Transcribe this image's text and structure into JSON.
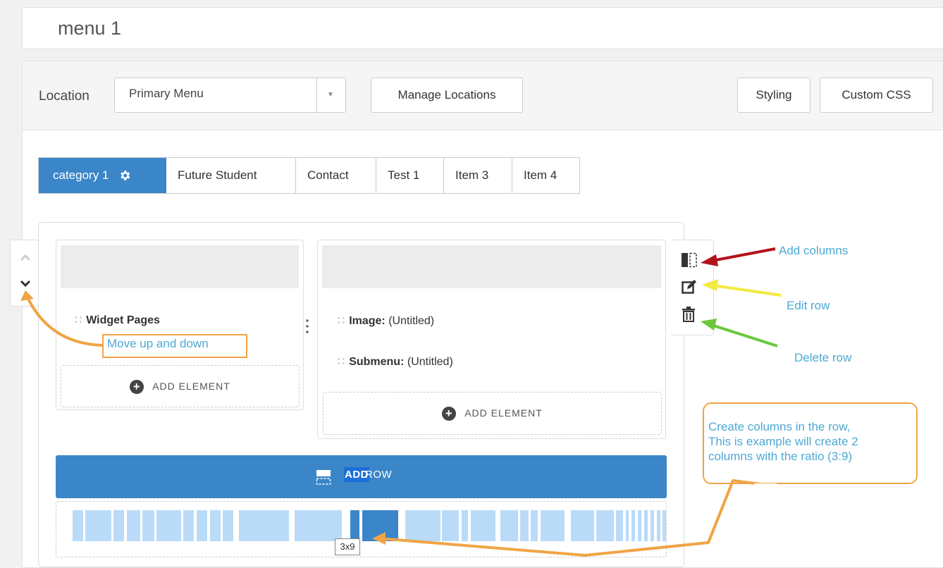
{
  "menu": {
    "name": "menu 1"
  },
  "location_bar": {
    "label": "Location",
    "select_value": "Primary Menu",
    "manage_button": "Manage Locations",
    "styling_button": "Styling",
    "custom_css_button": "Custom CSS"
  },
  "tabs": [
    {
      "label": "category 1",
      "active": true
    },
    {
      "label": "Future Student"
    },
    {
      "label": "Contact"
    },
    {
      "label": "Test 1"
    },
    {
      "label": "Item 3"
    },
    {
      "label": "Item 4"
    }
  ],
  "row": {
    "col1": {
      "elements": [
        {
          "type": "Widget Pages",
          "title": ""
        }
      ],
      "add_label": "ADD ELEMENT"
    },
    "col2": {
      "elements": [
        {
          "type": "Image:",
          "title": "(Untitled)"
        },
        {
          "type": "Submenu:",
          "title": "(Untitled)"
        }
      ],
      "add_label": "ADD ELEMENT"
    },
    "add_row": {
      "highlight": "ADD",
      "rest": " ROW"
    },
    "ratio_tooltip": "3x9"
  },
  "annotations": {
    "move": "Move up and down",
    "add_columns": "Add columns",
    "edit_row": "Edit row",
    "delete_row": "Delete row",
    "bubble_lines": [
      "Create columns in the row,",
      "This is example will create 2",
      "columns with the ratio (3:9)"
    ]
  },
  "colors": {
    "accent": "#3b86c8",
    "annotation_text": "#4ea9d3",
    "callout": "#f0a445"
  },
  "icons": [
    "gear-icon",
    "chevron-up-icon",
    "chevron-down-icon",
    "add-columns-icon",
    "edit-icon",
    "trash-icon",
    "add-row-icon",
    "plus-circle-icon",
    "drag-handle-icon"
  ]
}
